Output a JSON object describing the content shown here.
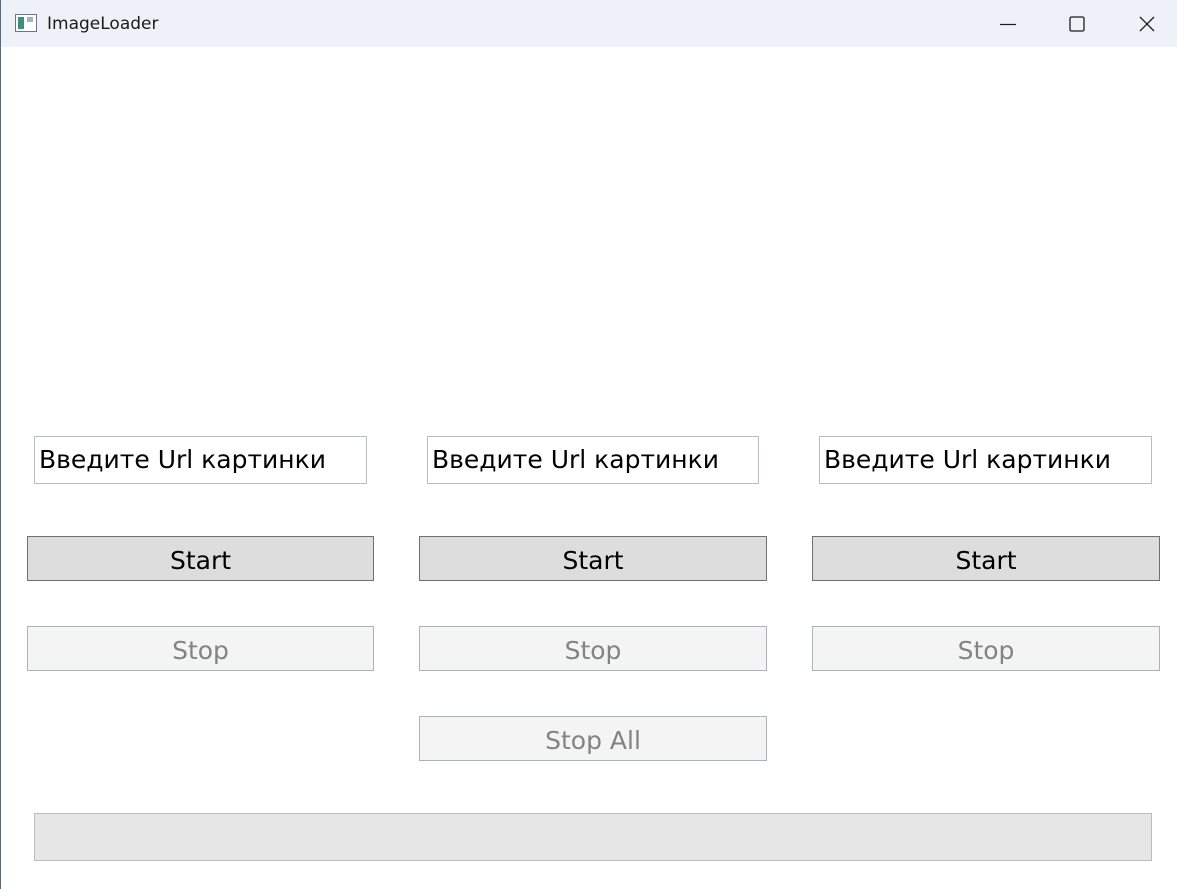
{
  "window": {
    "title": "ImageLoader",
    "app_icon": "window-app-icon",
    "controls": {
      "minimize_icon": "minimize-icon",
      "maximize_icon": "maximize-icon",
      "close_icon": "close-icon"
    }
  },
  "loaders": [
    {
      "url_value": "Введите Url картинки",
      "start_label": "Start",
      "stop_label": "Stop",
      "stop_enabled": false
    },
    {
      "url_value": "Введите Url картинки",
      "start_label": "Start",
      "stop_label": "Stop",
      "stop_enabled": false
    },
    {
      "url_value": "Введите Url картинки",
      "start_label": "Start",
      "stop_label": "Stop",
      "stop_enabled": false
    }
  ],
  "stop_all": {
    "label": "Stop All",
    "enabled": false
  },
  "progress": {
    "value": 0
  }
}
